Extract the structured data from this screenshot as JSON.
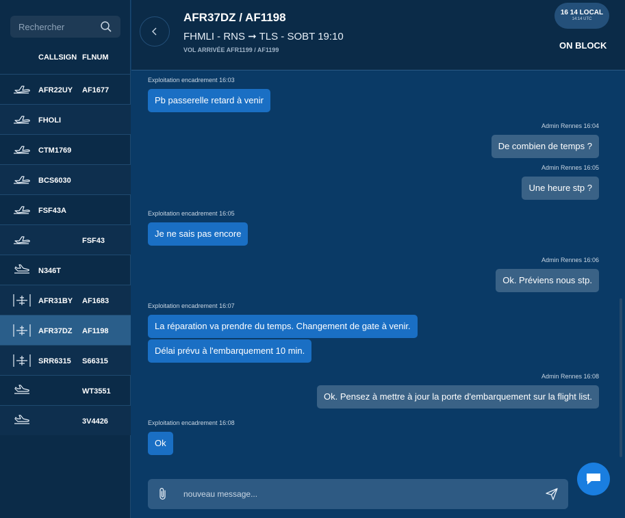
{
  "search": {
    "placeholder": "Rechercher",
    "icon": "search-icon"
  },
  "list_headers": {
    "callsign": "CALLSIGN",
    "flnum": "FLNUM"
  },
  "flights": [
    {
      "callsign": "AFR22UY",
      "flnum": "AF1677",
      "icon": "departure-plane-icon"
    },
    {
      "callsign": "FHOLI",
      "flnum": "",
      "icon": "departure-plane-icon"
    },
    {
      "callsign": "CTM1769",
      "flnum": "",
      "icon": "departure-plane-icon"
    },
    {
      "callsign": "BCS6030",
      "flnum": "",
      "icon": "departure-plane-icon"
    },
    {
      "callsign": "FSF43A",
      "flnum": "",
      "icon": "departure-plane-icon"
    },
    {
      "callsign": "",
      "flnum": "FSF43",
      "icon": "departure-plane-icon"
    },
    {
      "callsign": "N346T",
      "flnum": "",
      "icon": "arrival-plane-icon"
    },
    {
      "callsign": "AFR31BY",
      "flnum": "AF1683",
      "icon": "parked-plane-icon"
    },
    {
      "callsign": "AFR37DZ",
      "flnum": "AF1198",
      "icon": "parked-plane-icon",
      "selected": true
    },
    {
      "callsign": "SRR6315",
      "flnum": "S66315",
      "icon": "parked-plane-icon"
    },
    {
      "callsign": "",
      "flnum": "WT3551",
      "icon": "arrival-plane-icon"
    },
    {
      "callsign": "",
      "flnum": "3V4426",
      "icon": "arrival-plane-icon"
    }
  ],
  "header": {
    "title": "AFR37DZ / AF1198",
    "route": "FHMLI - RNS ➞ TLS - SOBT 19:10",
    "arrival": "VOL ARRIVÉE AFR1199 / AF1199",
    "time_local": "16 14 LOCAL",
    "time_utc": "14:14 UTC",
    "status": "ON BLOCK"
  },
  "messages": [
    {
      "side": "left",
      "meta": "Exploitation encadrement 16:03",
      "lines": [
        "Pb passerelle retard à venir"
      ]
    },
    {
      "side": "right",
      "meta": "Admin Rennes 16:04",
      "lines": [
        "De combien de temps ?"
      ]
    },
    {
      "side": "right",
      "meta": "Admin Rennes 16:05",
      "lines": [
        "Une heure stp ?"
      ]
    },
    {
      "side": "left",
      "meta": "Exploitation encadrement 16:05",
      "lines": [
        "Je ne sais pas encore"
      ]
    },
    {
      "side": "right",
      "meta": "Admin Rennes 16:06",
      "lines": [
        "Ok. Préviens nous stp."
      ]
    },
    {
      "side": "left",
      "meta": "Exploitation encadrement 16:07",
      "lines": [
        "La réparation va prendre du temps. Changement de gate à venir.",
        "Délai prévu à l'embarquement 10 min."
      ]
    },
    {
      "side": "right",
      "meta": "Admin Rennes 16:08",
      "lines": [
        "Ok. Pensez à mettre à jour la porte d'embarquement sur la flight list."
      ]
    },
    {
      "side": "left",
      "meta": "Exploitation encadrement 16:08",
      "lines": [
        "Ok"
      ]
    }
  ],
  "composer": {
    "placeholder": "nouveau message..."
  },
  "colors": {
    "sidebar": "#0b2b48",
    "chat_bg": "#0a3a66",
    "bubble_left": "#1a6fc4",
    "bubble_right": "#3a6286",
    "fab": "#1a7ee0"
  }
}
